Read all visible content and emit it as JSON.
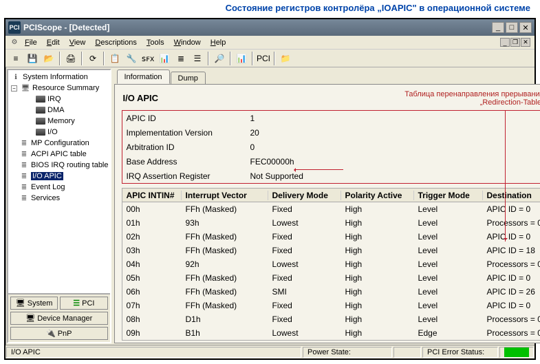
{
  "caption": "Состояние регистров контролёра „IOAPIC\" в операционной системе",
  "window_title": "PCIScope - [Detected]",
  "menu": {
    "icon": "⚙",
    "file": "File",
    "edit": "Edit",
    "view": "View",
    "descriptions": "Descriptions",
    "tools": "Tools",
    "window": "Window",
    "help": "Help"
  },
  "toolbar_icons": [
    "≡",
    "💾",
    "📂",
    "|",
    "🖨",
    "|",
    "⟳",
    "|",
    "📋",
    "🔧",
    "ꜱꜰx",
    "📊",
    "≣",
    "☰",
    "|",
    "🔎",
    "|",
    "📊",
    "|",
    "PCI",
    "|",
    "📁"
  ],
  "tree": {
    "root": "System Information",
    "summary": "Resource Summary",
    "items2": [
      "IRQ",
      "DMA",
      "Memory",
      "I/O"
    ],
    "items1": [
      "MP Configuration",
      "ACPI APIC table",
      "BIOS IRQ routing table",
      "I/O APIC",
      "Event Log",
      "Services"
    ],
    "selected": "I/O APIC"
  },
  "sidebar_buttons": {
    "system": "System",
    "pci": "PCI",
    "dm": "Device Manager",
    "pnp": "PnP"
  },
  "tabs": {
    "info": "Information",
    "dump": "Dump"
  },
  "heading": "I/O APIC",
  "annotation": {
    "line1": "Таблица перенаправления прерываний",
    "line2": "„Redirection-Table\""
  },
  "props": [
    {
      "k": "APIC ID",
      "v": "1"
    },
    {
      "k": "Implementation Version",
      "v": "20"
    },
    {
      "k": "Arbitration ID",
      "v": "0"
    },
    {
      "k": "Base Address",
      "v": "FEC00000h"
    },
    {
      "k": "IRQ Assertion Register",
      "v": "Not Supported"
    }
  ],
  "grid_headers": [
    "APIC INTIN#",
    "Interrupt Vector",
    "Delivery Mode",
    "Polarity Active",
    "Trigger Mode",
    "Destination"
  ],
  "grid_rows": [
    {
      "c": [
        "00h",
        "FFh (Masked)",
        "Fixed",
        "High",
        "Level",
        "APIC ID = 0"
      ]
    },
    {
      "c": [
        "01h",
        "93h",
        "Lowest",
        "High",
        "Level",
        "Processors = 0"
      ]
    },
    {
      "c": [
        "02h",
        "FFh (Masked)",
        "Fixed",
        "High",
        "Level",
        "APIC ID = 0"
      ]
    },
    {
      "c": [
        "03h",
        "FFh (Masked)",
        "Fixed",
        "High",
        "Level",
        "APIC ID = 18"
      ]
    },
    {
      "c": [
        "04h",
        "92h",
        "Lowest",
        "High",
        "Level",
        "Processors = 0"
      ]
    },
    {
      "c": [
        "05h",
        "FFh (Masked)",
        "Fixed",
        "High",
        "Level",
        "APIC ID = 0"
      ]
    },
    {
      "c": [
        "06h",
        "FFh (Masked)",
        "SMI",
        "High",
        "Level",
        "APIC ID = 26"
      ]
    },
    {
      "c": [
        "07h",
        "FFh (Masked)",
        "Fixed",
        "High",
        "Level",
        "APIC ID = 0"
      ]
    },
    {
      "c": [
        "08h",
        "D1h",
        "Fixed",
        "High",
        "Level",
        "Processors = 0"
      ]
    },
    {
      "c": [
        "09h",
        "B1h",
        "Lowest",
        "High",
        "Edge",
        "Processors = 0"
      ]
    }
  ],
  "status": {
    "left": "I/O APIC",
    "power": "Power State:",
    "pcierr": "PCI Error Status:"
  },
  "colors": {
    "status_ok": "#00C000"
  }
}
